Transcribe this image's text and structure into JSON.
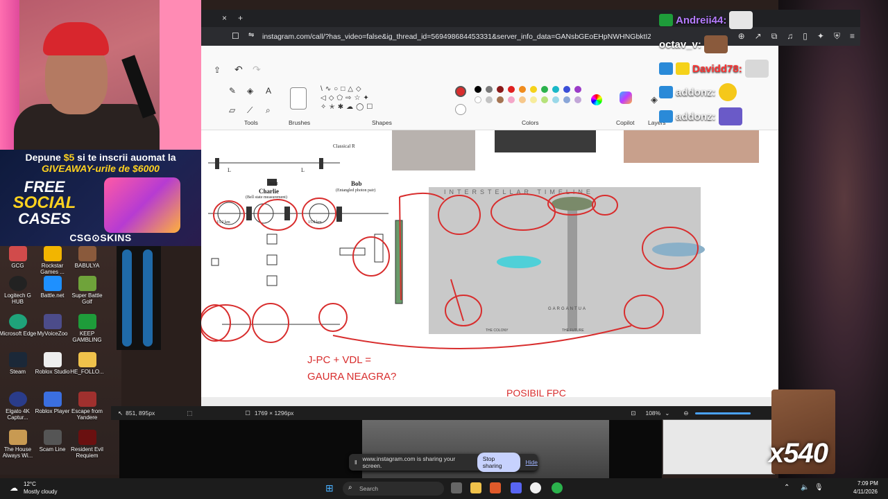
{
  "browser": {
    "url": "instagram.com/call/?has_video=false&ig_thread_id=569498684453331&server_info_data=GANsbGEoEHpNWHNGbktIZGh3U...",
    "tab_close": "×",
    "tab_new": "+"
  },
  "paint": {
    "groups": {
      "tools": "Tools",
      "brushes": "Brushes",
      "shapes": "Shapes",
      "colors": "Colors",
      "copilot": "Copilot",
      "layers": "Layers"
    },
    "status": {
      "cursor": "851, 895px",
      "canvas_size": "1769 × 1296px",
      "zoom": "108%"
    },
    "annotations": [
      "J-PC + VDL =",
      "GAURA NEAGRA?",
      "POSIBIL FPC"
    ],
    "diagram_labels": {
      "charlie": "Charlie",
      "charlie_sub": "(Bell state measurement)",
      "bob": "Bob",
      "bob_sub": "(Entangled photon pair)",
      "classical": "Classical R",
      "bsm": "BSM",
      "l_ac": "L",
      "l_bc": "L",
      "fiber1": "15.2 km",
      "fiber2": "15.0 km",
      "timeline": "INTERSTELLAR TIMELINE",
      "gargantua": "GARGANTUA",
      "colony": "THE COLONY",
      "future": "THE FUTURE"
    }
  },
  "chat": {
    "lines": [
      {
        "name": "Andreii44:",
        "color": "#b57cff"
      },
      {
        "name": "octav_v:",
        "color": "#ffffff"
      },
      {
        "name": "Davidd78:",
        "color": "#ff3434"
      },
      {
        "name": "addonz:",
        "color": "#f2f2f2"
      },
      {
        "name": "addonz:",
        "color": "#f2f2f2"
      }
    ]
  },
  "ad": {
    "line1_pre": "Depune ",
    "line1_amount": "$5",
    "line1_post": " si te inscrii auomat la",
    "line2_pre": "GIVEAWAY-urile de ",
    "line2_amount": "$6000",
    "free_top": "FREE",
    "free_mid": "SOCIAL",
    "free_bot": "CASES",
    "brand": "CSG⊙SKINS"
  },
  "desktop_icons": [
    "GCG",
    "Rockstar Games ...",
    "BABULYA",
    "Logitech G HUB",
    "Battle.net",
    "Super Battle Golf",
    "Microsoft Edge",
    "MyVoiceZoo",
    "KEEP GAMBLING",
    "Steam",
    "Roblox Studio",
    "HE_FOLLO...",
    "Elgato 4K Captur...",
    "Roblox Player",
    "Escape from Yandere",
    "The House Always Wi...",
    "Scam Line",
    "Resident Evil Requiem"
  ],
  "share_bar": {
    "text": "www.instagram.com is sharing your screen.",
    "stop": "Stop sharing",
    "hide": "Hide"
  },
  "taskbar": {
    "weather_temp": "12°C",
    "weather_desc": "Mostly cloudy",
    "search": "Search",
    "time": "7:09 PM",
    "date": "4/11/2026"
  },
  "overlay": {
    "multiplier": "x540"
  },
  "colors": {
    "accent": "#d82d2d",
    "chat_purple": "#b57cff",
    "ad_yellow": "#ffd21f"
  }
}
